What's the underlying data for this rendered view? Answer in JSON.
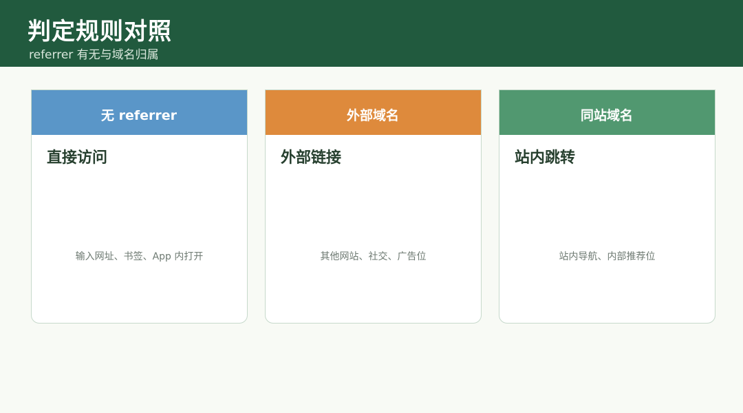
{
  "header": {
    "title": "判定规则对照",
    "subtitle": "referrer 有无与域名归属",
    "background": "#215a3e"
  },
  "cards": [
    {
      "label": "无 referrer",
      "color": "#5a96c8",
      "heading": "直接访问",
      "description": "输入网址、书签、App 内打开"
    },
    {
      "label": "外部域名",
      "color": "#de8a3c",
      "heading": "外部链接",
      "description": "其他网站、社交、广告位"
    },
    {
      "label": "同站域名",
      "color": "#519870",
      "heading": "站内跳转",
      "description": "站内导航、内部推荐位"
    }
  ]
}
